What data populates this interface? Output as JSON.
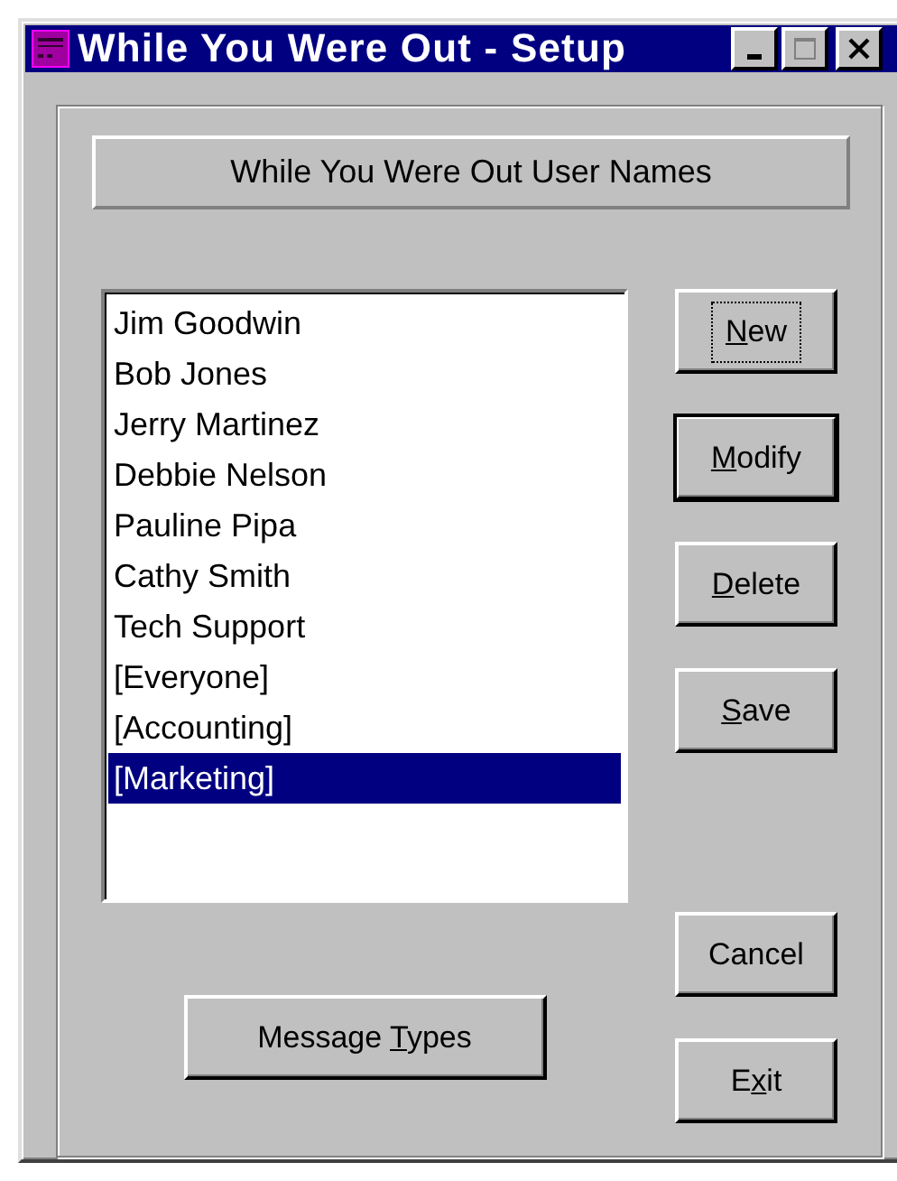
{
  "window": {
    "title": "While You Were Out - Setup"
  },
  "header": "While You Were Out User Names",
  "users": [
    {
      "name": "Jim Goodwin",
      "selected": false
    },
    {
      "name": "Bob Jones",
      "selected": false
    },
    {
      "name": "Jerry Martinez",
      "selected": false
    },
    {
      "name": "Debbie Nelson",
      "selected": false
    },
    {
      "name": "Pauline Pipa",
      "selected": false
    },
    {
      "name": "Cathy Smith",
      "selected": false
    },
    {
      "name": "Tech Support",
      "selected": false
    },
    {
      "name": "[Everyone]",
      "selected": false
    },
    {
      "name": "[Accounting]",
      "selected": false
    },
    {
      "name": "[Marketing]",
      "selected": true
    }
  ],
  "side_buttons": [
    {
      "key": "N",
      "post": "ew",
      "focused": true,
      "default": false
    },
    {
      "key": "M",
      "post": "odify",
      "focused": false,
      "default": true
    },
    {
      "key": "D",
      "post": "elete",
      "focused": false,
      "default": false
    },
    {
      "key": "S",
      "post": "ave",
      "focused": false,
      "default": false
    }
  ],
  "lower_buttons": [
    {
      "pre": "Cancel",
      "focused": false,
      "default": false
    }
  ],
  "message_types_button": {
    "pre": "Message ",
    "key": "T",
    "post": "ypes",
    "focused": false,
    "default": false
  },
  "exit_button": {
    "pre": "E",
    "key": "x",
    "post": "it",
    "focused": false,
    "default": false
  }
}
